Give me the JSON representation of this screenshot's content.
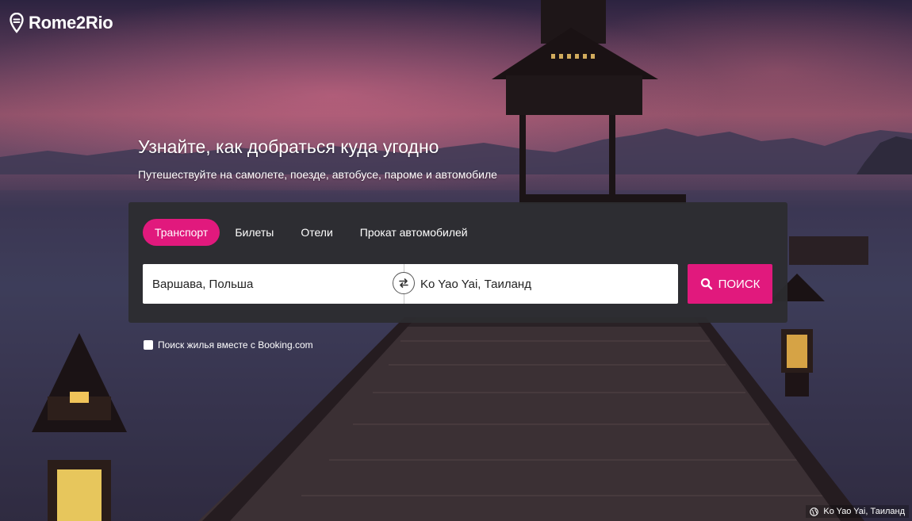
{
  "brand": {
    "name": "Rome2Rio"
  },
  "hero": {
    "headline": "Узнайте, как добраться куда угодно",
    "subheadline": "Путешествуйте на самолете, поезде, автобусе, пароме и автомобиле"
  },
  "tabs": [
    {
      "label": "Транспорт",
      "active": true
    },
    {
      "label": "Билеты",
      "active": false
    },
    {
      "label": "Отели",
      "active": false
    },
    {
      "label": "Прокат автомобилей",
      "active": false
    }
  ],
  "search": {
    "from_value": "Варшава, Польша",
    "to_value": "Ko Yao Yai, Таиланд",
    "button_label": "поиск",
    "button_icon": "search-icon",
    "swap_icon": "swap-arrows-icon"
  },
  "booking": {
    "label": "Поиск жилья вместе с Booking.com",
    "checked": false
  },
  "photo_credit": {
    "icon": "globe-icon",
    "label": "Ko Yao Yai, Таиланд"
  },
  "colors": {
    "accent": "#e1197d",
    "panel": "#2d2d30"
  }
}
